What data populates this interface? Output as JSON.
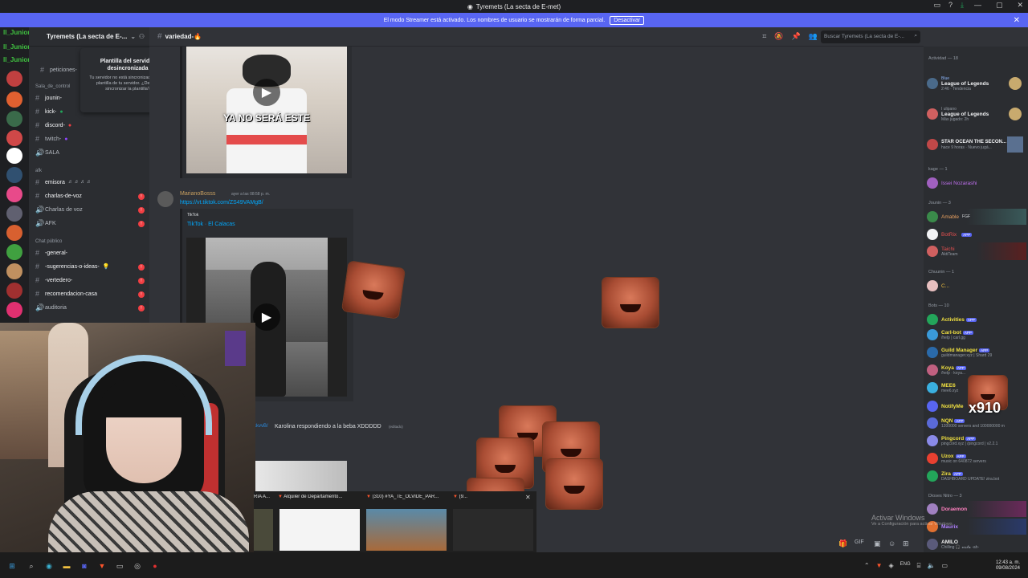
{
  "window": {
    "title": "Tyremets (La secta de E-met)"
  },
  "banner": {
    "text": "El modo Streamer está activado. Los nombres de usuario se mostrarán de forma parcial.",
    "button": "Desactivar"
  },
  "server": {
    "name": "Tyremets (La secta de E-...",
    "current_channel": "variedad-",
    "search_placeholder": "Buscar Tyremets (La secta de E-..."
  },
  "popup": {
    "title": "Plantilla del servidor desincronizada",
    "message": "Tu servidor no está sincronizado con la plantilla de tu servidor. ¿Deseas sincronizar la plantilla?"
  },
  "overlay_names": [
    "ll_Junior_ll :",
    "ll_Junior_ll :",
    "ll_Junior_ll :"
  ],
  "channels": [
    {
      "label": "peticiones-",
      "type": "text"
    },
    {
      "label": "Sala_de_control",
      "type": "category"
    },
    {
      "label": "jounin-",
      "type": "text"
    },
    {
      "label": "kick-",
      "type": "text"
    },
    {
      "label": "discord-",
      "type": "text"
    },
    {
      "label": "twitch-",
      "type": "text"
    },
    {
      "label": "SALA",
      "type": "voice"
    },
    {
      "label": "emisora",
      "type": "text"
    },
    {
      "label": "charlas-de-voz",
      "type": "text"
    },
    {
      "label": "Charlas de voz",
      "type": "voice"
    },
    {
      "label": "AFK",
      "type": "voice"
    },
    {
      "label": "Chat público",
      "type": "category"
    },
    {
      "label": "-general-",
      "type": "text"
    },
    {
      "label": "-sugerencias-o-ideas-",
      "type": "text"
    },
    {
      "label": "-vertedero-",
      "type": "text"
    },
    {
      "label": "recomendacion-casa",
      "type": "text"
    },
    {
      "label": "auditoria",
      "type": "voice"
    }
  ],
  "messages": {
    "video1_caption": "YA NO SERÁ ESTE",
    "author2": "MarianoBosss",
    "time2": "ayer a las 08:58 p. m.",
    "link2": "https://vt.tiktok.com/ZS49VAMgB/",
    "embed_provider": "TikTok",
    "embed_title": "TikTok · El Calacas",
    "author3": "ckvvB/",
    "text3": "Karolina respondiendo a la beba XDDDDD",
    "edited3": "(editado)"
  },
  "members": {
    "activity_header": "Actividad — 18",
    "activity": [
      {
        "name": "Blue",
        "game": "League of Legends",
        "sub": "2:46 · Tendencia"
      },
      {
        "name": "I ulipano",
        "game": "League of Legends",
        "sub": "Más jugado: 2h"
      },
      {
        "name": "",
        "game": "STAR OCEAN THE SECON...",
        "sub": "hace 9 horas · Nuevo jugá..."
      }
    ],
    "group1_header": "kage — 1",
    "group1": [
      {
        "name": "Issei Nozarashi",
        "color": "#c070f0"
      }
    ],
    "group2_header": "Jounin — 3",
    "group2": [
      {
        "name": "Amable",
        "color": "#e8a060",
        "tag": "FGF"
      },
      {
        "name": "BotRix",
        "color": "#e85050",
        "tag": "APP"
      },
      {
        "name": "Taichi",
        "color": "#e85050",
        "sub": "AktiTeam"
      }
    ],
    "group3_header": "Chuunin — 1",
    "group3": [
      {
        "name": "C...",
        "color": "#f0c040"
      }
    ],
    "bots_header": "Bots — 10",
    "bots": [
      {
        "name": "Activities",
        "color": "#f0e040",
        "sub": ""
      },
      {
        "name": "Carl-bot",
        "color": "#f0e040",
        "sub": "/help | carl.gg"
      },
      {
        "name": "Guild Manager",
        "color": "#f0e040",
        "sub": "guildmanager.xyz | Shard 29"
      },
      {
        "name": "Koya",
        "color": "#f0e040",
        "sub": "/help · koya..."
      },
      {
        "name": "MEE6",
        "color": "#f0e040",
        "sub": "mee6.xyz"
      },
      {
        "name": "NotifyMe",
        "color": "#f0e040",
        "sub": ""
      },
      {
        "name": "NQN",
        "color": "#f0e040",
        "sub": "1200000 servers and 100000000 m"
      },
      {
        "name": "Pingcord",
        "color": "#f0e040",
        "sub": "pingcord.xyz | /pingcord | v2.2.1"
      },
      {
        "name": "Uzox",
        "color": "#f0e040",
        "sub": "music on 640872 servers"
      },
      {
        "name": "Zira",
        "color": "#f0e040",
        "sub": "DASHBOARD UPDATE! zira.bot"
      }
    ],
    "nitro_header": "Dioses Nitro — 3",
    "nitro": [
      {
        "name": "Doraemon",
        "color": "#ff80c0"
      },
      {
        "name": "Maurix",
        "color": "#b080ff"
      },
      {
        "name": "AMILO",
        "color": "#f0f0f0",
        "sub": "Chilling 🎧 𝓿𝓲𝓼𝓽𝓪 -ah-"
      }
    ],
    "x910": "x910"
  },
  "previews": [
    {
      "label": "RÍA A..."
    },
    {
      "label": "Alquiler de Departamento..."
    },
    {
      "label": "(310) #YA_TE_OLVIDE_PAR..."
    },
    {
      "label": "(9..."
    }
  ],
  "watermark": {
    "title": "Activar Windows",
    "sub": "Ve a Configuración para activar Windows."
  },
  "tray": {
    "lang": "ENG",
    "time": "12:43 a. m.",
    "date": "09/08/2024"
  },
  "colors": {
    "banner": "#5865f2",
    "badge": "#f23f43",
    "link": "#00a8fc",
    "app_tag": "#5865f2"
  }
}
